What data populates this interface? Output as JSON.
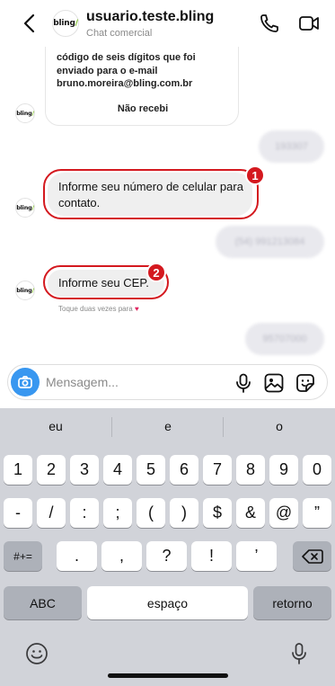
{
  "header": {
    "title": "usuario.teste.bling",
    "subtitle": "Chat comercial",
    "avatar_logo": "bling",
    "icons": [
      "back-icon",
      "phone-icon",
      "video-call-icon"
    ]
  },
  "chat": {
    "card": {
      "text": "código de seis dígitos que foi\nenviado para o e-mail\nbruno.moreira@bling.com.br",
      "button_label": "Não recebi"
    },
    "messages": [
      {
        "from": "user",
        "text": "193307"
      },
      {
        "from": "bot",
        "text": "Informe seu número de celular para contato.",
        "badge": "1"
      },
      {
        "from": "user",
        "text": "(54) 991213084"
      },
      {
        "from": "bot",
        "text": "Informe seu CEP.",
        "badge": "2"
      },
      {
        "from": "user",
        "text": "95707000"
      }
    ],
    "hint": "Toque duas vezes para",
    "highlight_color": "#d4191f"
  },
  "composer": {
    "placeholder": "Mensagem...",
    "icons": [
      "camera-icon",
      "microphone-icon",
      "image-icon",
      "sticker-icon"
    ],
    "accent": "#3897f0"
  },
  "keyboard": {
    "suggestions": [
      "eu",
      "e",
      "o"
    ],
    "row1": [
      "1",
      "2",
      "3",
      "4",
      "5",
      "6",
      "7",
      "8",
      "9",
      "0"
    ],
    "row2": [
      "-",
      "/",
      ":",
      ";",
      "(",
      ")",
      "$",
      "&",
      "@",
      "”"
    ],
    "row3": {
      "shift": "#+=",
      "keys": [
        ".",
        ",",
        "?",
        "!",
        "’"
      ],
      "delete": "delete-icon"
    },
    "row4": {
      "abc": "ABC",
      "space": "espaço",
      "return": "retorno"
    },
    "icons": [
      "emoji-icon",
      "dictation-mic-icon"
    ]
  }
}
